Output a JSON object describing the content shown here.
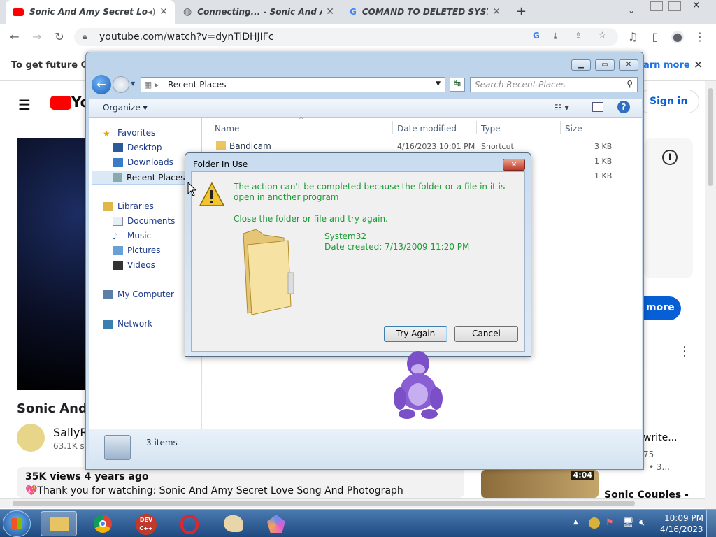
{
  "browser": {
    "tabs": [
      {
        "title": "Sonic And Amy Secret Lo",
        "active": true,
        "audio": true
      },
      {
        "title": "Connecting... - Sonic And Am",
        "active": false
      },
      {
        "title": "COMAND TO DELETED SYST",
        "active": false
      }
    ],
    "new_tab": "+",
    "url": "youtube.com/watch?v=dynTiDHJIFc",
    "infobar_text": "To get future Go",
    "infobar_link": "arn more"
  },
  "youtube": {
    "signin": "Sign in",
    "more_btn": "more",
    "title": "Sonic And A",
    "channel": "SallyR",
    "subs": "63.1K su",
    "stats": "35K views  4 years ago",
    "description": "💖Thank you for watching: Sonic And Amy Secret Love Song And Photograph",
    "side_texts": [
      "write...",
      "75",
      "• 3...",
      "Sonic Couples -"
    ],
    "duration": "4:04"
  },
  "explorer": {
    "breadcrumb": "Recent Places",
    "search_placeholder": "Search Recent Places",
    "organize": "Organize",
    "nav": {
      "favorites": "Favorites",
      "desktop": "Desktop",
      "downloads": "Downloads",
      "recent": "Recent Places",
      "libraries": "Libraries",
      "documents": "Documents",
      "music": "Music",
      "pictures": "Pictures",
      "videos": "Videos",
      "computer": "My Computer",
      "network": "Network"
    },
    "columns": {
      "name": "Name",
      "date": "Date modified",
      "type": "Type",
      "size": "Size"
    },
    "rows": [
      {
        "name": "Bandicam",
        "date": "4/16/2023 10:01 PM",
        "type": "Shortcut",
        "size": "3 KB"
      },
      {
        "name": "",
        "date": "",
        "type": "",
        "size": "1 KB"
      },
      {
        "name": "",
        "date": "",
        "type": "",
        "size": "1 KB"
      }
    ],
    "status": "3 items"
  },
  "dialog": {
    "title": "Folder In Use",
    "message": "The action can't be completed because the folder or a file in it is open in another program",
    "hint": "Close the folder or file and try again.",
    "item_name": "System32",
    "item_date": "Date created: 7/13/2009 11:20 PM",
    "try_again": "Try Again",
    "cancel": "Cancel"
  },
  "taskbar": {
    "time": "10:09 PM",
    "date": "4/16/2023"
  },
  "colors": {
    "dialog_text": "#1b9a32",
    "taskbar": "#1e4a80",
    "yt_red": "#ff0000"
  }
}
